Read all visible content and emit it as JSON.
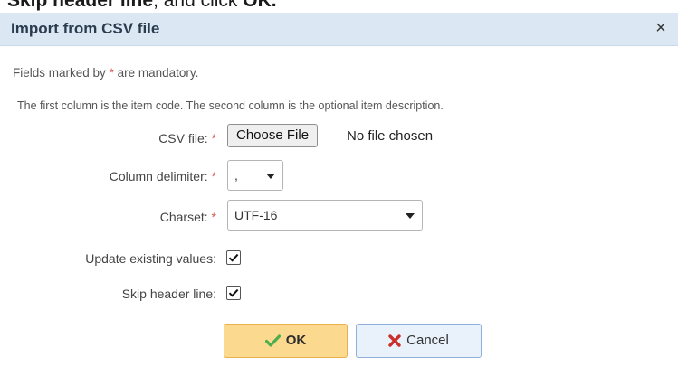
{
  "top_caption": {
    "bold": "Skip header line",
    "rest": ", and click ",
    "ok": "OK."
  },
  "dialog": {
    "title": "Import from CSV file",
    "close_symbol": "×",
    "mandatory_note_prefix": "Fields marked by ",
    "mandatory_asterisk": "*",
    "mandatory_note_suffix": " are mandatory.",
    "description": "The first column is the item code. The second column is the optional item description.",
    "fields": {
      "csv_file": {
        "label": "CSV file:",
        "required": "*",
        "button": "Choose File",
        "status": "No file chosen"
      },
      "column_delimiter": {
        "label": "Column delimiter:",
        "required": "*",
        "value": ","
      },
      "charset": {
        "label": "Charset:",
        "required": "*",
        "value": "UTF-16"
      },
      "update_existing": {
        "label": "Update existing values:",
        "checked": true
      },
      "skip_header": {
        "label": "Skip header line:",
        "checked": true
      }
    },
    "buttons": {
      "ok": {
        "label": "OK",
        "icon": "checkmark-icon",
        "color": "#4cae4c"
      },
      "cancel": {
        "label": "Cancel",
        "icon": "x-icon",
        "color": "#c9302c"
      }
    }
  }
}
